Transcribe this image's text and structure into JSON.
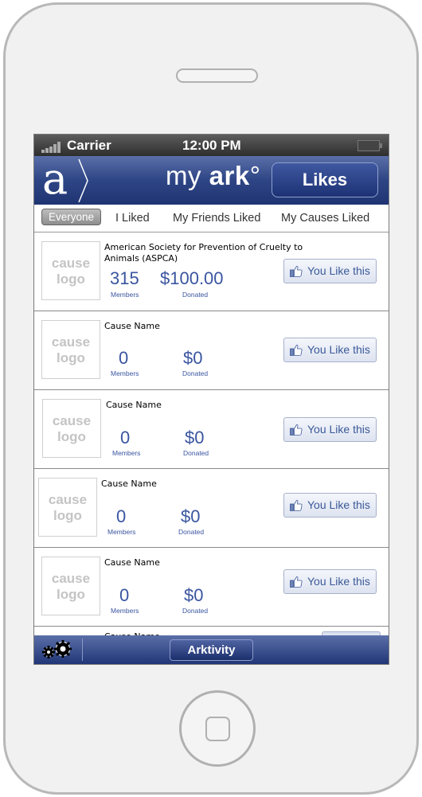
{
  "status_bar": {
    "carrier": "Carrier",
    "time": "12:00 PM"
  },
  "header": {
    "logo_letter": "a",
    "brand_light": "my ",
    "brand_bold": "ark",
    "brand_mark": "°",
    "likes_button": "Likes"
  },
  "filters": {
    "everyone": "Everyone",
    "i_liked": "I Liked",
    "friends_liked": "My Friends Liked",
    "causes_liked": "My Causes Liked"
  },
  "common": {
    "logo_line1": "cause",
    "logo_line2": "logo",
    "members_label": "Members",
    "donated_label": "Donated",
    "like_button": "You Like this"
  },
  "causes": [
    {
      "name": "American Society for Prevention of Cruelty to Animals (ASPCA)",
      "members": "315",
      "donated": "$100.00"
    },
    {
      "name": "Cause Name",
      "members": "0",
      "donated": "$0"
    },
    {
      "name": "Cause Name",
      "members": "0",
      "donated": "$0"
    },
    {
      "name": "Cause Name",
      "members": "0",
      "donated": "$0"
    },
    {
      "name": "Cause Name",
      "members": "0",
      "donated": "$0"
    },
    {
      "name": "Cause Name"
    }
  ],
  "toolbar": {
    "arktivity_button": "Arktivity"
  },
  "colors": {
    "brand_blue": "#2e4585",
    "stat_blue": "#3a55a0",
    "facebook_blue": "#3b5998"
  }
}
